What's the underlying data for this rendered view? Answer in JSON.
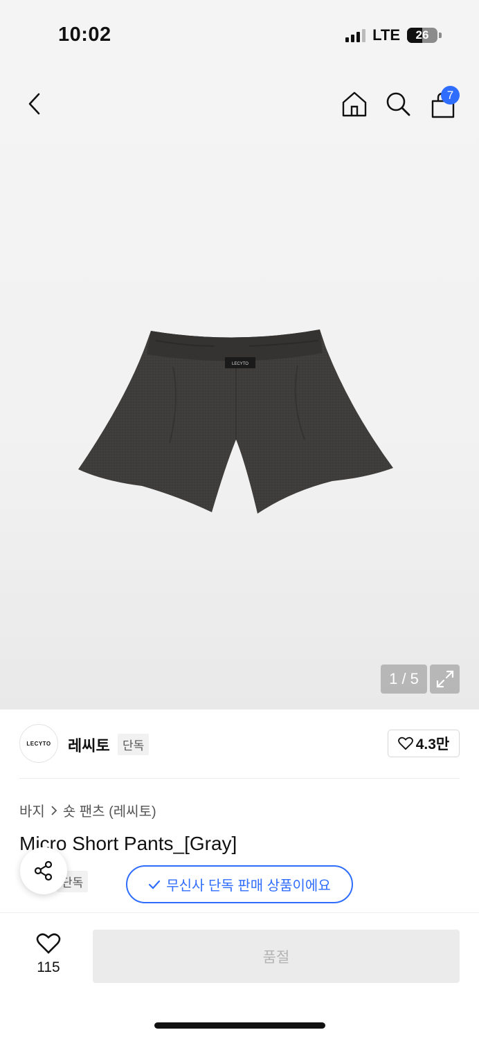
{
  "status": {
    "time": "10:02",
    "network": "LTE",
    "battery": "26"
  },
  "nav": {
    "back_icon": "chevron-left-icon",
    "home_icon": "home-icon",
    "search_icon": "search-icon",
    "cart_icon": "shopping-bag-icon",
    "cart_count": "7"
  },
  "gallery": {
    "counter": "1 / 5",
    "expand_icon": "expand-icon",
    "label_on_product": "LECYTO"
  },
  "brand": {
    "logo_text": "LECYTO",
    "name": "레씨토",
    "tag": "단독",
    "likes": "4.3만"
  },
  "breadcrumb": {
    "category": "바지",
    "subcategory": "숏 팬츠 (레씨토)"
  },
  "product": {
    "title": "Micro Short Pants_[Gray]",
    "tag": "단독",
    "notice": "무신사 단독 판매 상품이에요"
  },
  "bottom": {
    "wish_count": "115",
    "buy_label": "품절"
  },
  "colors": {
    "accent": "#2f6dff",
    "product": "#3d3b39"
  }
}
